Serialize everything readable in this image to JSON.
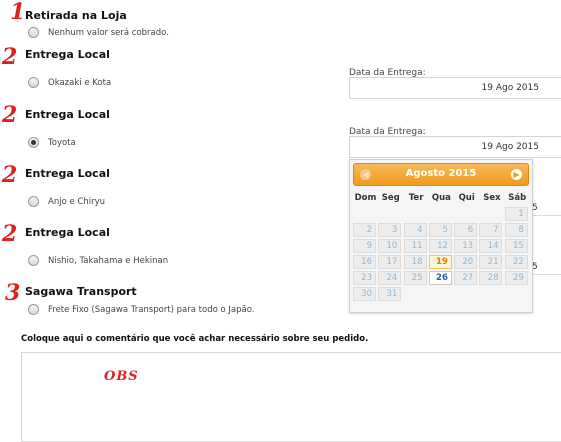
{
  "sections": [
    {
      "number": "1",
      "title": "Retirada na Loja",
      "option": "Nenhum valor será cobrado.",
      "checked": false
    },
    {
      "number": "2",
      "title": "Entrega Local",
      "option": "Okazaki e Kota",
      "checked": false,
      "date_label": "Data da Entrega:",
      "date_value": "19 Ago 2015"
    },
    {
      "number": "2",
      "title": "Entrega Local",
      "option": "Toyota",
      "checked": true,
      "date_label": "Data da Entrega:",
      "date_value": "19 Ago 2015"
    },
    {
      "number": "2",
      "title": "Entrega Local",
      "option": "Anjo e Chiryu",
      "checked": false,
      "date_value_partial": "5"
    },
    {
      "number": "2",
      "title": "Entrega Local",
      "option": "Nishio, Takahama e Hekinan",
      "checked": false,
      "date_value_partial": "5"
    },
    {
      "number": "3",
      "title": "Sagawa Transport",
      "option": "Frete Fixo (Sagawa Transport) para todo o Japão.",
      "checked": false
    }
  ],
  "calendar": {
    "month_title": "Agosto 2015",
    "prev_icon": "chevron-left-icon",
    "next_icon": "chevron-right-icon",
    "weekdays": [
      "Dom",
      "Seg",
      "Ter",
      "Qua",
      "Qui",
      "Sex",
      "Sáb"
    ],
    "weeks": [
      [
        "",
        "",
        "",
        "",
        "",
        "",
        "1"
      ],
      [
        "2",
        "3",
        "4",
        "5",
        "6",
        "7",
        "8"
      ],
      [
        "9",
        "10",
        "11",
        "12",
        "13",
        "14",
        "15"
      ],
      [
        "16",
        "17",
        "18",
        "19",
        "20",
        "21",
        "22"
      ],
      [
        "23",
        "24",
        "25",
        "26",
        "27",
        "28",
        "29"
      ],
      [
        "30",
        "31",
        "",
        "",
        "",
        "",
        ""
      ]
    ],
    "today": "19",
    "selected": "26",
    "accent": "#f09b1c"
  },
  "comment": {
    "label": "Coloque aqui o comentário que você achar necessário sobre seu pedido.",
    "annotation": "OBS"
  },
  "colors": {
    "annotation": "#e02020"
  }
}
